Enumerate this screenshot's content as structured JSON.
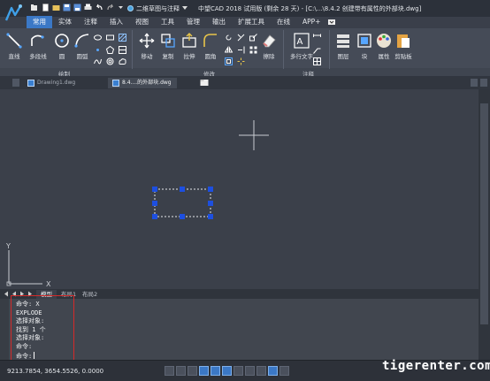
{
  "app": {
    "workspace": "二维草图与注释",
    "window_title": "中望CAD 2018 试用版 (剩余 28 天) - [C:\\...\\8.4.2  创建带有属性的外部块.dwg]"
  },
  "menu": {
    "tabs": [
      "常用",
      "实体",
      "注释",
      "插入",
      "视图",
      "工具",
      "管理",
      "输出",
      "扩展工具",
      "在线",
      "APP+"
    ],
    "active": "常用"
  },
  "ribbon": {
    "draw": {
      "line": "直线",
      "polyline": "多段线",
      "circle": "圆",
      "arc": "圆弧",
      "group": "绘制"
    },
    "modify": {
      "move": "移动",
      "copy": "复制",
      "stretch": "拉伸",
      "fillet": "圆角",
      "erase": "擦除",
      "group": "修改"
    },
    "annotate": {
      "mtext": "多行文字",
      "group": "注释"
    },
    "layers": "图层",
    "block": "块",
    "properties": "属性",
    "clipboard": "剪贴板"
  },
  "doc_tabs": {
    "tab1": "Drawing1.dwg",
    "tab2": "8.4....的外部块.dwg"
  },
  "layout_tabs": {
    "model": "模型",
    "layout1": "布局1",
    "layout2": "布局2"
  },
  "command": {
    "lines": [
      "命令: X",
      "EXPLODE",
      "选择对象:",
      "找到 1 个",
      "选择对象:",
      "命令:"
    ],
    "prompt": "命令:"
  },
  "status": {
    "coords": "9213.7854, 3654.5526, 0.0000"
  },
  "ucs": {
    "x_label": "X",
    "y_label": "Y"
  },
  "watermark": "tigerenter.com",
  "colors": {
    "accent": "#3b78c6",
    "grip": "#1d4fe0",
    "highlight_box": "#d42a2a"
  }
}
